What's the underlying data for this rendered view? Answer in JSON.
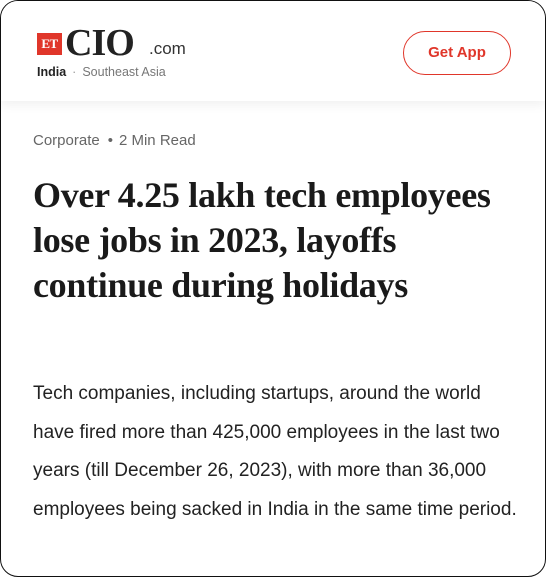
{
  "header": {
    "logo": {
      "badge": "ET",
      "brand": "CIO",
      "suffix": ".com"
    },
    "region": {
      "primary": "India",
      "separator": "·",
      "secondary": "Southeast Asia"
    },
    "get_app_label": "Get App"
  },
  "article": {
    "category": "Corporate",
    "separator": "•",
    "read_time": "2 Min Read",
    "headline": "Over 4.25 lakh tech employees lose jobs in 2023, layoffs continue during holidays",
    "summary": "Tech companies, including startups, around the world have fired more than 425,000 employees in the last two years (till December 26, 2023), with more than 36,000 employees being sacked in India in the same time period."
  },
  "colors": {
    "accent": "#e0362a",
    "headline_text": "#1a1a1a",
    "meta_text": "#666666"
  }
}
